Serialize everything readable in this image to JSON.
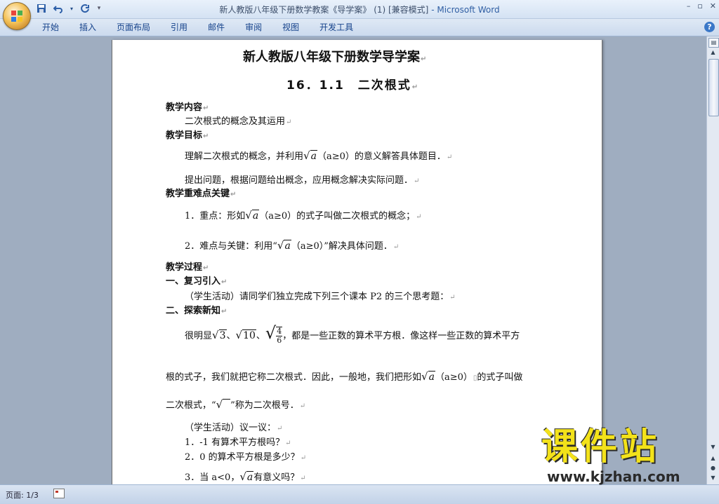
{
  "window": {
    "title": "新人教版八年级下册数学教案《导学案》 (1) [兼容模式]",
    "app_suffix": " - Microsoft Word",
    "controls": [
      "–",
      "▫",
      "✕"
    ]
  },
  "qat": {
    "save_icon": "save-icon",
    "undo_icon": "undo-icon",
    "redo_icon": "redo-icon",
    "customize_icon": "customize-qat-icon"
  },
  "ribbon": {
    "tabs": [
      "开始",
      "插入",
      "页面布局",
      "引用",
      "邮件",
      "审阅",
      "视图",
      "开发工具"
    ],
    "help": "?"
  },
  "doc": {
    "title": "新人教版八年级下册数学导学案",
    "subtitle": "16．1.1　二次根式",
    "s1": "教学内容",
    "s1_text": "二次根式的概念及其运用",
    "s2": "教学目标",
    "obj1_a": "理解二次根式的概念，并利用",
    "obj1_b": "（a≥0）的意义解答具体题目．",
    "obj2": "提出问题，根据问题给出概念，应用概念解决实际问题．",
    "s3": "教学重难点关键",
    "key1_a": "1．重点：形如",
    "key1_b": "（a≥0）的式子叫做二次根式的概念；",
    "key2_a": "2．难点与关键：利用“",
    "key2_b": "（a≥0）”解决具体问题．",
    "s4": "教学过程",
    "s5": "一、复习引入",
    "review": "（学生活动）请同学们独立完成下列三个课本 P2 的三个思考题：",
    "s6": "二、探索新知",
    "para1_a": "很明显",
    "para1_b": "，都是一些正数的算术平方根．像这样一些正数的算术平方",
    "para2_a": "根的式子，我们就把它称二次根式．因此，一般地，我们把形如",
    "para2_b": "（a≥0）",
    "para2_c": "的式子叫做",
    "para3_a": "二次根式，“",
    "para3_b": "”称为二次根号．",
    "activity": "（学生活动）议一议：",
    "q1": "1．-1 有算术平方根吗？",
    "q2": "2．0 的算术平方根是多少？",
    "q3_a": "3．当 a<0，",
    "q3_b": "有意义吗？"
  },
  "math": {
    "rad": "√",
    "a": "a",
    "three": "3",
    "ten": "10",
    "num4": "4",
    "den6": "6",
    "sep": "、"
  },
  "status": {
    "page": "页面: 1/3"
  },
  "watermark": {
    "title": "课件站",
    "url": "www.kjzhan.com"
  }
}
